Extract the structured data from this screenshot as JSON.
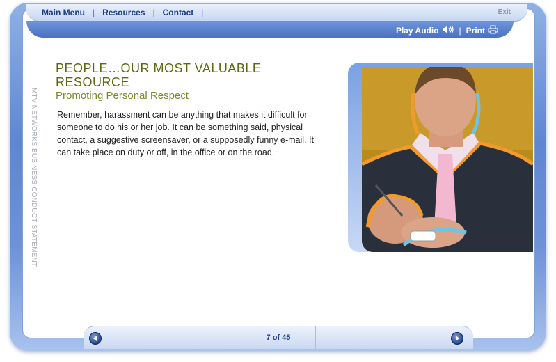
{
  "nav": {
    "items": [
      "Main Menu",
      "Resources",
      "Contact"
    ],
    "separator": "|",
    "exit_label": "Exit"
  },
  "toolbar": {
    "play_audio_label": "Play Audio",
    "print_label": "Print",
    "separator": "|"
  },
  "side_label": "MTV NETWORKS BUSINESS CONDUCT STATEMENT",
  "content": {
    "title": "PEOPLE…OUR MOST VALUABLE RESOURCE",
    "subtitle": "Promoting Personal Respect",
    "body": "Remember, harassment can be anything that makes it difficult for someone to do his or her job. It can be something said, physical contact, a suggestive screensaver, or a supposedly funny e-mail. It can take place on duty or off, in the office or on the road."
  },
  "pager": {
    "label": "7 of 45",
    "current": 7,
    "total": 45
  },
  "icons": {
    "audio": "speaker-icon",
    "print": "printer-icon",
    "prev": "arrow-left-icon",
    "next": "arrow-right-icon"
  },
  "colors": {
    "frame_blue": "#5f86d1",
    "nav_text": "#1d3f86",
    "title_olive": "#5a6a12",
    "subtitle_olive": "#7a8a2a"
  }
}
